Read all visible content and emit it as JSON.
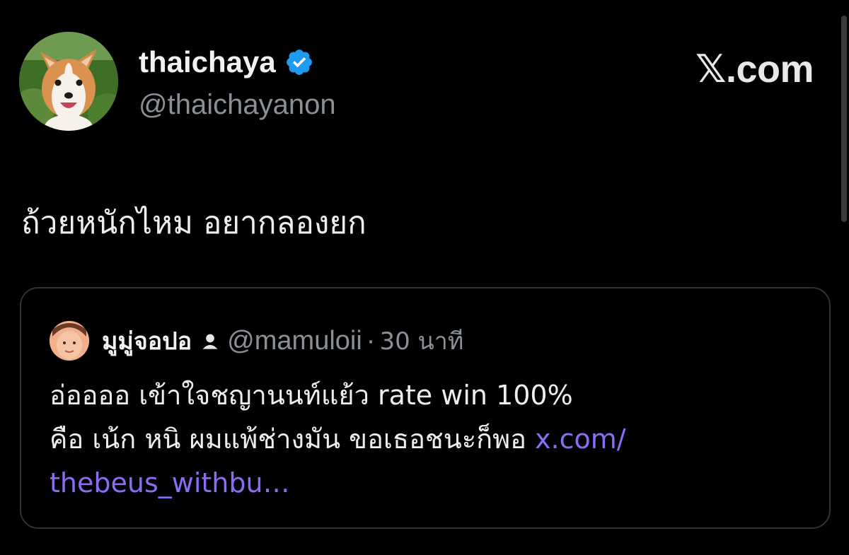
{
  "author": {
    "display_name": "thaichaya",
    "handle": "@thaichayanon",
    "verified": true,
    "avatar_icon": "corgi-avatar"
  },
  "brand": {
    "label": "𝕏.com"
  },
  "tweet": {
    "text": "ถ้วยหนักไหม อยากลองยก"
  },
  "quote": {
    "author_name": "มูมู่จอปอ",
    "author_icon": "person-icon",
    "handle": "@mamuloii",
    "separator": "·",
    "time": "30 นาที",
    "line1": "อ่ออออ เข้าใจชญานนท์แย้ว rate win 100%",
    "line2_text": "คือ เน้ก หนิ ผมแพ้ช่างมัน ขอเธอชนะก็พอ ",
    "link_part1": "x.com/",
    "link_part2": "thebeus_withbu…"
  },
  "colors": {
    "background": "#000000",
    "text": "#e7e9ea",
    "muted": "#8b9097",
    "link": "#8a6cf5",
    "verified_badge": "#1d9bf0",
    "card_border": "#2f3336"
  }
}
